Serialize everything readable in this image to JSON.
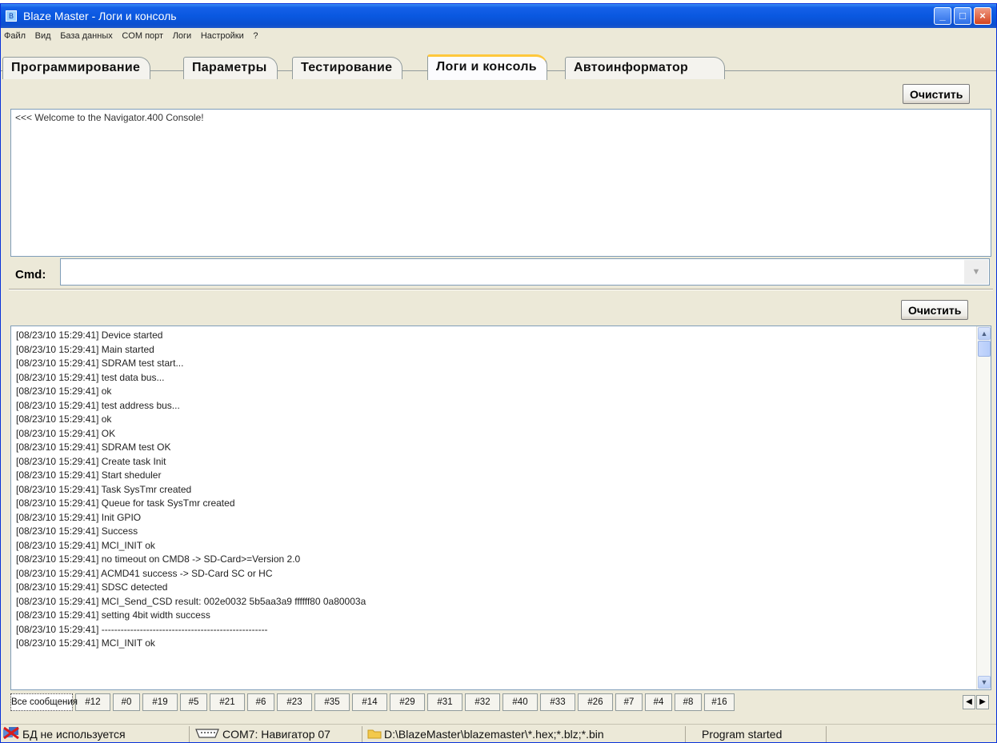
{
  "window": {
    "title": "Blaze Master - Логи и консоль"
  },
  "menu": [
    "Файл",
    "Вид",
    "База данных",
    "COM порт",
    "Логи",
    "Настройки",
    "?"
  ],
  "tabs": [
    {
      "label": "Программирование",
      "active": false
    },
    {
      "label": "Параметры",
      "active": false
    },
    {
      "label": "Тестирование",
      "active": false
    },
    {
      "label": "Логи и консоль",
      "active": true
    },
    {
      "label": "Автоинформатор",
      "active": false
    }
  ],
  "console": {
    "clear_label": "Очистить",
    "text": "<<< Welcome to the Navigator.400 Console!",
    "cmd_label": "Cmd:",
    "cmd_value": ""
  },
  "log": {
    "clear_label": "Очистить",
    "lines": [
      "[08/23/10 15:29:41] Device started",
      "[08/23/10 15:29:41] Main started",
      "[08/23/10 15:29:41] SDRAM test start...",
      "[08/23/10 15:29:41] test data bus...",
      "[08/23/10 15:29:41]   ok",
      "[08/23/10 15:29:41] test address bus...",
      "[08/23/10 15:29:41]   ok",
      "[08/23/10 15:29:41] OK",
      "[08/23/10 15:29:41] SDRAM test OK",
      "[08/23/10 15:29:41] Create task Init",
      "[08/23/10 15:29:41] Start sheduler",
      "[08/23/10 15:29:41] Task SysTmr created",
      "[08/23/10 15:29:41] Queue for task SysTmr created",
      "[08/23/10 15:29:41] Init GPIO",
      "[08/23/10 15:29:41] Success",
      "[08/23/10 15:29:41] MCI_INIT ok",
      "[08/23/10 15:29:41] no timeout on CMD8 -> SD-Card>=Version 2.0",
      "[08/23/10 15:29:41] ACMD41 success -> SD-Card SC or HC",
      "[08/23/10 15:29:41] SDSC detected",
      "[08/23/10 15:29:41] MCI_Send_CSD result: 002e0032 5b5aa3a9 ffffff80 0a80003a",
      "[08/23/10 15:29:41] setting 4bit width success",
      "[08/23/10 15:29:41] ----------------------------------------------------",
      "[08/23/10 15:29:41] MCI_INIT ok"
    ]
  },
  "filter_tabs": [
    "Все сообщения",
    "#12",
    "#0",
    "#19",
    "#5",
    "#21",
    "#6",
    "#23",
    "#35",
    "#14",
    "#29",
    "#31",
    "#32",
    "#40",
    "#33",
    "#26",
    "#7",
    "#4",
    "#8",
    "#16"
  ],
  "status": {
    "db": "БД не используется",
    "com": "COM7: Навигатор 07",
    "path": "D:\\BlazeMaster\\blazemaster\\*.hex;*.blz;*.bin",
    "state": "Program started"
  },
  "colors": {
    "titlebar": "#0b4fd0",
    "active_tab_accent": "#ffc83c",
    "scroll": "#b8cdf6"
  }
}
